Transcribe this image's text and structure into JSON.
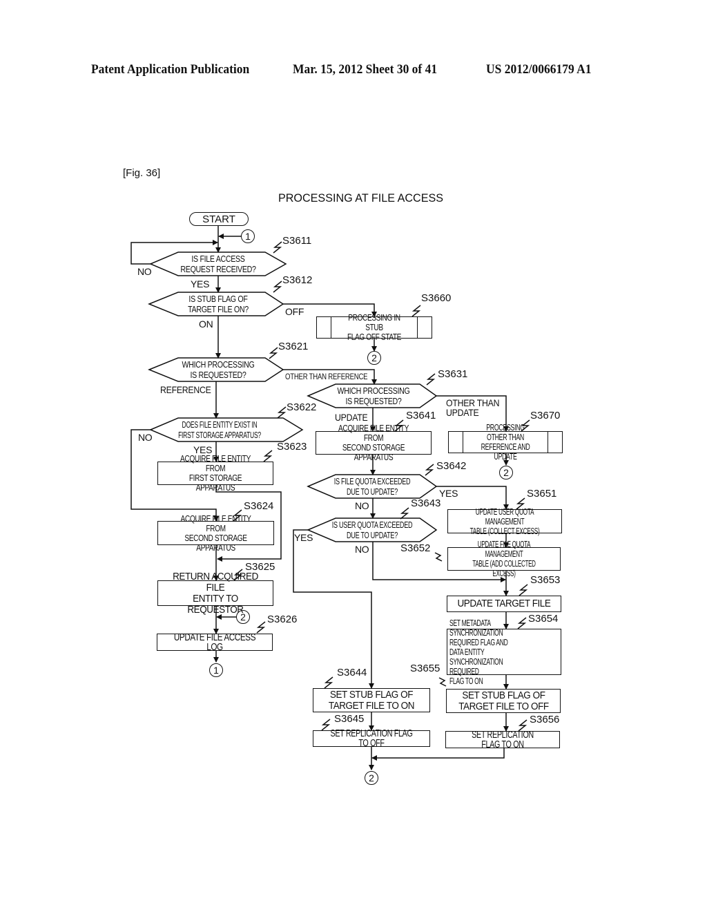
{
  "header": {
    "publication": "Patent Application Publication",
    "date_sheet": "Mar. 15, 2012  Sheet 30 of 41",
    "patent_number": "US 2012/0066179 A1"
  },
  "figure": {
    "label": "[Fig. 36]",
    "title": "PROCESSING AT FILE ACCESS"
  },
  "flowchart": {
    "start": "START",
    "connectors": {
      "c1": "1",
      "c2": "2"
    },
    "decisions": {
      "s3611": {
        "step": "S3611",
        "text": "IS FILE ACCESS\nREQUEST RECEIVED?",
        "yes": "YES",
        "no": "NO"
      },
      "s3612": {
        "step": "S3612",
        "text": "IS STUB FLAG OF\nTARGET FILE ON?",
        "on": "ON",
        "off": "OFF"
      },
      "s3621": {
        "step": "S3621",
        "text": "WHICH PROCESSING\nIS REQUESTED?",
        "reference": "REFERENCE",
        "other": "OTHER THAN REFERENCE"
      },
      "s3622": {
        "step": "S3622",
        "text": "DOES FILE ENTITY EXIST IN\nFIRST STORAGE APPARATUS?",
        "yes": "YES",
        "no": "NO"
      },
      "s3631": {
        "step": "S3631",
        "text": "WHICH PROCESSING\nIS REQUESTED?",
        "update": "UPDATE",
        "other": "OTHER THAN\nUPDATE"
      },
      "s3642": {
        "step": "S3642",
        "text": "IS FILE QUOTA EXCEEDED\nDUE TO UPDATE?",
        "yes": "YES",
        "no": "NO"
      },
      "s3643": {
        "step": "S3643",
        "text": "IS USER QUOTA EXCEEDED\nDUE TO UPDATE?",
        "yes": "YES",
        "no": "NO"
      }
    },
    "processes": {
      "s3660": {
        "step": "S3660",
        "text": "PROCESSING IN STUB\nFLAG OFF STATE"
      },
      "s3670": {
        "step": "S3670",
        "text": "PROCESSING OTHER THAN\nREFERENCE AND UPDATE"
      },
      "s3623": {
        "step": "S3623",
        "text": "ACQUIRE FILE ENTITY FROM\nFIRST STORAGE APPARATUS"
      },
      "s3624": {
        "step": "S3624",
        "text": "ACQUIRE FILE ENTITY FROM\nSECOND STORAGE APPARATUS"
      },
      "s3625": {
        "step": "S3625",
        "text": "RETURN ACQUIRED FILE\nENTITY TO REQUESTOR"
      },
      "s3626": {
        "step": "S3626",
        "text": "UPDATE FILE ACCESS LOG"
      },
      "s3641": {
        "step": "S3641",
        "text": "ACQUIRE FILE ENTITY FROM\nSECOND STORAGE APPARATUS"
      },
      "s3651": {
        "step": "S3651",
        "text": "UPDATE USER QUOTA MANAGEMENT\nTABLE (COLLECT EXCESS)"
      },
      "s3652": {
        "step": "S3652",
        "text": "UPDATE FILE QUOTA MANAGEMENT\nTABLE (ADD COLLECTED EXCESS)"
      },
      "s3653": {
        "step": "S3653",
        "text": "UPDATE TARGET FILE"
      },
      "s3654": {
        "step": "S3654",
        "text": "SET METADATA SYNCHRONIZATION\nREQUIRED FLAG AND DATA ENTITY\nSYNCHRONIZATION REQUIRED\nFLAG TO ON"
      },
      "s3644": {
        "step": "S3644",
        "text": "SET STUB FLAG OF\nTARGET FILE TO ON"
      },
      "s3645": {
        "step": "S3645",
        "text": "SET REPLICATION FLAG TO OFF"
      },
      "s3655": {
        "step": "S3655",
        "text": "SET STUB FLAG OF\nTARGET FILE TO OFF"
      },
      "s3656": {
        "step": "S3656",
        "text": "SET REPLICATION FLAG TO ON"
      }
    }
  }
}
